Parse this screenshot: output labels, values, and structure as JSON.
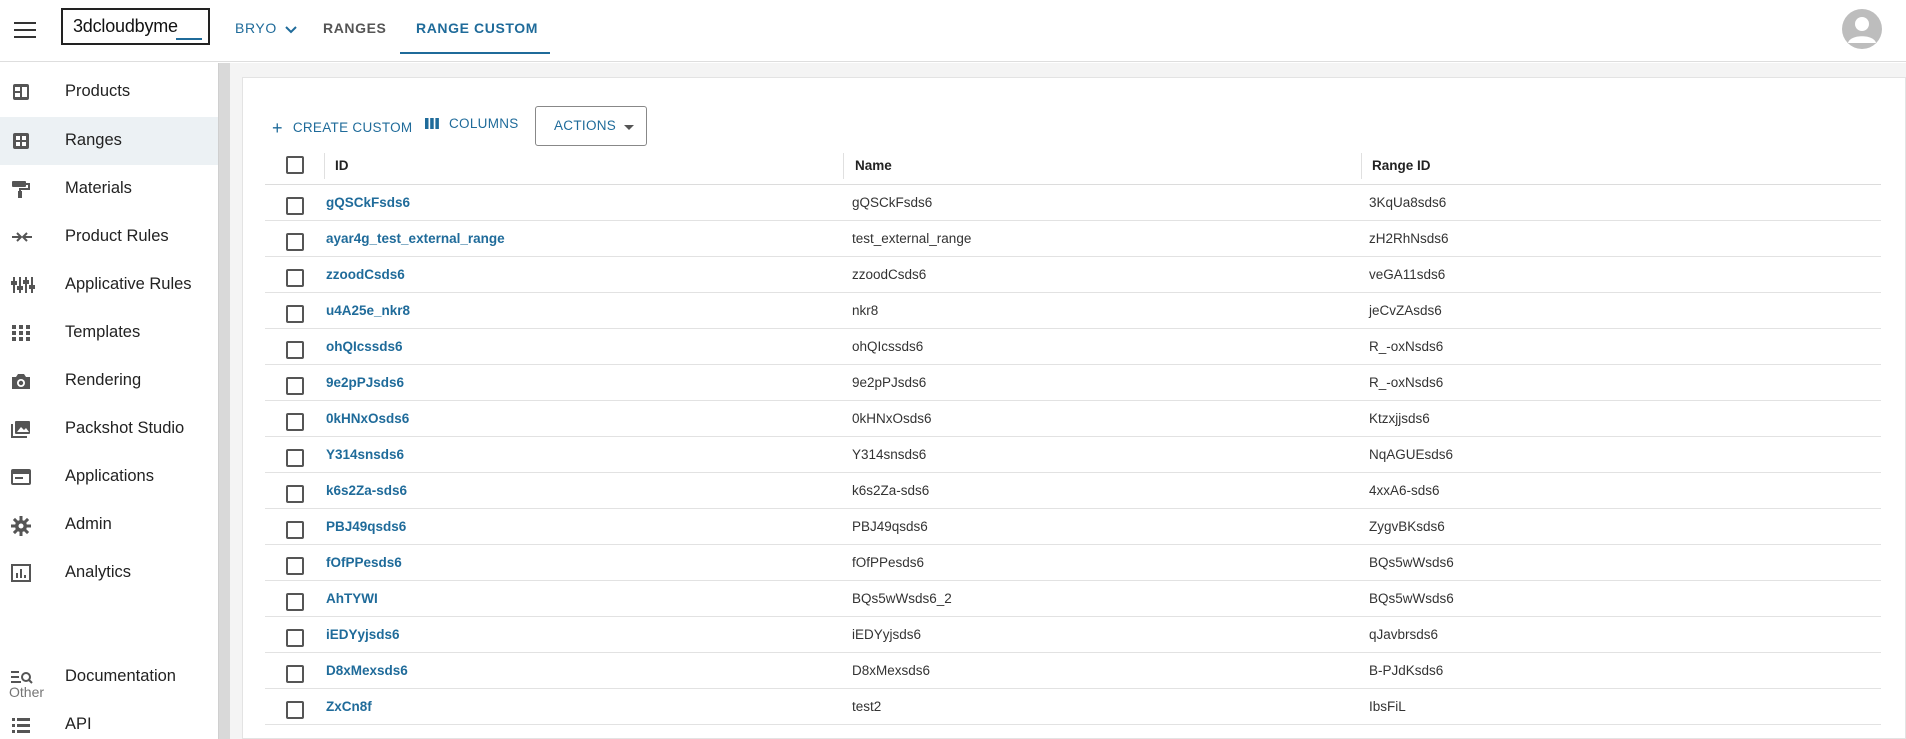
{
  "header": {
    "logo_text": "3dcloudbyme",
    "tabs": [
      {
        "label": "BRYO"
      },
      {
        "label": "RANGES"
      },
      {
        "label": "RANGE CUSTOM"
      }
    ]
  },
  "sidebar": {
    "items": [
      {
        "label": "Products",
        "icon": "products-icon"
      },
      {
        "label": "Ranges",
        "icon": "ranges-icon"
      },
      {
        "label": "Materials",
        "icon": "paint-roller-icon"
      },
      {
        "label": "Product Rules",
        "icon": "rules-arrows-icon"
      },
      {
        "label": "Applicative Rules",
        "icon": "sliders-icon"
      },
      {
        "label": "Templates",
        "icon": "grid-dots-icon"
      },
      {
        "label": "Rendering",
        "icon": "camera-icon"
      },
      {
        "label": "Packshot Studio",
        "icon": "photo-library-icon"
      },
      {
        "label": "Applications",
        "icon": "window-icon"
      },
      {
        "label": "Admin",
        "icon": "gear-icon"
      },
      {
        "label": "Analytics",
        "icon": "analytics-icon"
      }
    ],
    "section_other": "Other",
    "other_items": [
      {
        "label": "Documentation",
        "icon": "doc-search-icon"
      },
      {
        "label": "API",
        "icon": "list-icon"
      }
    ]
  },
  "toolbar": {
    "create_label": "CREATE CUSTOM",
    "columns_label": "COLUMNS",
    "actions_label": "ACTIONS"
  },
  "table": {
    "columns": [
      "ID",
      "Name",
      "Range ID"
    ],
    "rows": [
      {
        "id": "gQSCkFsds6",
        "name": "gQSCkFsds6",
        "range_id": "3KqUa8sds6"
      },
      {
        "id": "ayar4g_test_external_range",
        "name": "test_external_range",
        "range_id": "zH2RhNsds6"
      },
      {
        "id": "zzoodCsds6",
        "name": "zzoodCsds6",
        "range_id": "veGA11sds6"
      },
      {
        "id": "u4A25e_nkr8",
        "name": "nkr8",
        "range_id": "jeCvZAsds6"
      },
      {
        "id": "ohQIcssds6",
        "name": "ohQIcssds6",
        "range_id": "R_-oxNsds6"
      },
      {
        "id": "9e2pPJsds6",
        "name": "9e2pPJsds6",
        "range_id": "R_-oxNsds6"
      },
      {
        "id": "0kHNxOsds6",
        "name": "0kHNxOsds6",
        "range_id": "Ktzxjjsds6"
      },
      {
        "id": "Y314snsds6",
        "name": "Y314snsds6",
        "range_id": "NqAGUEsds6"
      },
      {
        "id": "k6s2Za-sds6",
        "name": "k6s2Za-sds6",
        "range_id": "4xxA6-sds6"
      },
      {
        "id": "PBJ49qsds6",
        "name": "PBJ49qsds6",
        "range_id": "ZygvBKsds6"
      },
      {
        "id": "fOfPPesds6",
        "name": "fOfPPesds6",
        "range_id": "BQs5wWsds6"
      },
      {
        "id": "AhTYWI",
        "name": "BQs5wWsds6_2",
        "range_id": "BQs5wWsds6"
      },
      {
        "id": "iEDYyjsds6",
        "name": "iEDYyjsds6",
        "range_id": "qJavbrsds6"
      },
      {
        "id": "D8xMexsds6",
        "name": "D8xMexsds6",
        "range_id": "B-PJdKsds6"
      },
      {
        "id": "ZxCn8f",
        "name": "test2",
        "range_id": "IbsFiL"
      }
    ]
  },
  "colors": {
    "accent": "#1f6b9a",
    "active_bg": "#ecf1f4"
  }
}
